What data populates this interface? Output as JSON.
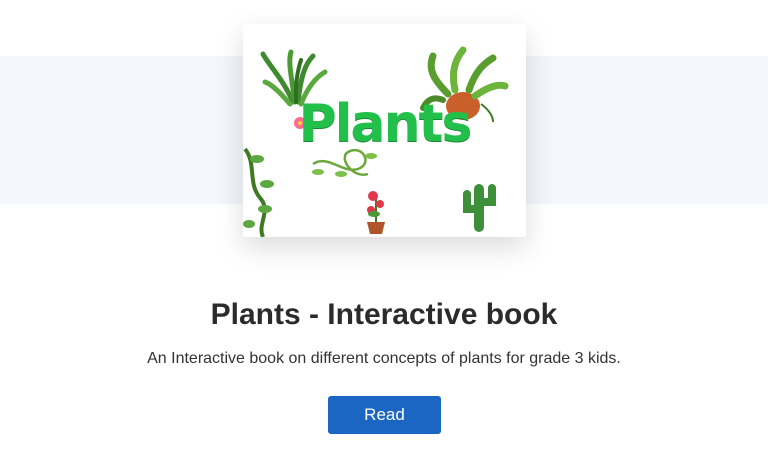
{
  "book": {
    "cover_title": "Plants",
    "title": "Plants - Interactive book",
    "description": "An Interactive book on different concepts of plants for grade 3 kids.",
    "read_label": "Read"
  },
  "colors": {
    "band": "#f3f6fa",
    "cover_title_green": "#22c04a",
    "read_button": "#1a66c2",
    "title_text": "#2b2b2b"
  }
}
